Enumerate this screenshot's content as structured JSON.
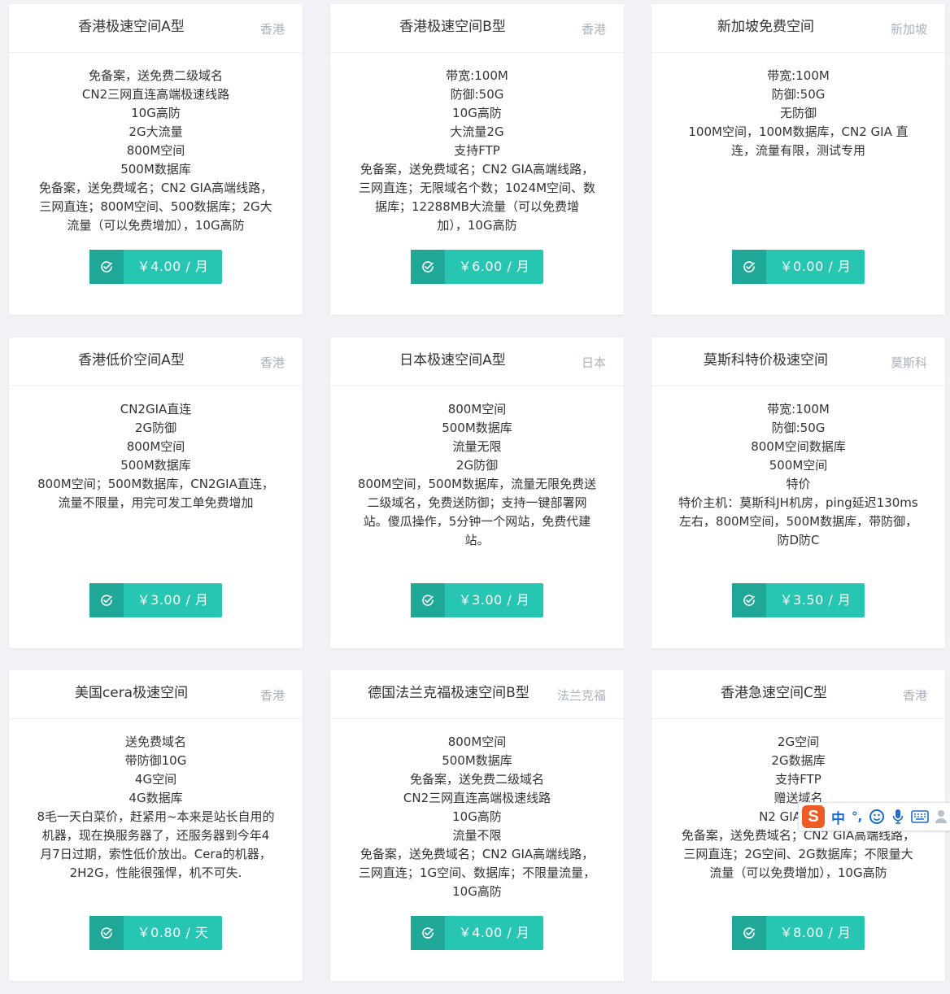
{
  "products": [
    {
      "title": "香港极速空间A型",
      "region": "香港",
      "lines": [
        "免备案，送免费二级域名",
        "CN2三网直连高端极速线路",
        "10G高防",
        "2G大流量",
        "800M空间",
        "500M数据库",
        "免备案，送免费域名；CN2 GIA高端线路，",
        "三网直连；800M空间、500数据库；2G大",
        "流量（可以免费增加），10G高防"
      ],
      "price": "￥4.00 / 月"
    },
    {
      "title": "香港极速空间B型",
      "region": "香港",
      "lines": [
        "带宽:100M",
        "防御:50G",
        "10G高防",
        "大流量2G",
        "支持FTP",
        "免备案，送免费域名；CN2 GIA高端线路，",
        "三网直连；无限域名个数；1024M空间、数",
        "据库；12288MB大流量（可以免费增",
        "加），10G高防"
      ],
      "price": "￥6.00 / 月"
    },
    {
      "title": "新加坡免费空间",
      "region": "新加坡",
      "lines": [
        "带宽:100M",
        "防御:50G",
        "无防御",
        "100M空间，100M数据库，CN2 GIA 直",
        "连，流量有限，测试专用"
      ],
      "price": "￥0.00 / 月"
    },
    {
      "title": "香港低价空间A型",
      "region": "香港",
      "lines": [
        "CN2GIA直连",
        "2G防御",
        "800M空间",
        "500M数据库",
        "800M空间；500M数据库，CN2GIA直连，",
        "流量不限量，用完可发工单免费增加"
      ],
      "price": "￥3.00 / 月"
    },
    {
      "title": "日本极速空间A型",
      "region": "日本",
      "lines": [
        "800M空间",
        "500M数据库",
        "流量无限",
        "2G防御",
        "800M空间，500M数据库，流量无限免费送",
        "二级域名，免费送防御；支持一键部署网",
        "站。傻瓜操作，5分钟一个网站，免费代建",
        "站。"
      ],
      "price": "￥3.00 / 月"
    },
    {
      "title": "莫斯科特价极速空间",
      "region": "莫斯科",
      "lines": [
        "带宽:100M",
        "防御:50G",
        "800M空间数据库",
        "500M空间",
        "特价",
        "特价主机：莫斯科JH机房，ping延迟130ms",
        "左右，800M空间，500M数据库，带防御，",
        "防D防C"
      ],
      "price": "￥3.50 / 月"
    },
    {
      "title": "美国cera极速空间",
      "region": "香港",
      "lines": [
        "送免费域名",
        "带防御10G",
        "4G空间",
        "4G数据库",
        "8毛一天白菜价，赶紧用~本来是站长自用的",
        "机器，现在换服务器了，还服务器到今年4",
        "月7日过期，索性低价放出。Cera的机器，",
        "2H2G，性能很强悍，机不可失."
      ],
      "price": "￥0.80 / 天"
    },
    {
      "title": "德国法兰克福极速空间B型",
      "region": "法兰克福",
      "lines": [
        "800M空间",
        "500M数据库",
        "免备案，送免费二级域名",
        "CN2三网直连高端极速线路",
        "10G高防",
        "流量不限",
        "免备案，送免费域名；CN2 GIA高端线路，",
        "三网直连；1G空间、数据库；不限量流量，",
        "10G高防"
      ],
      "price": "￥4.00 / 月"
    },
    {
      "title": "香港急速空间C型",
      "region": "香港",
      "lines": [
        "2G空间",
        "2G数据库",
        "支持FTP",
        "赠送域名",
        "N2 GIA高端线",
        "免备案，送免费域名；CN2 GIA高端线路，",
        "三网直连；2G空间、2G数据库；不限量大",
        "流量（可以免费增加），10G高防"
      ],
      "price": "￥8.00 / 月"
    }
  ],
  "ime_toolbar": {
    "logo": "S",
    "mode": "中",
    "punct": "°,"
  },
  "colors": {
    "button": "#26c6b2",
    "button_icon_bg": "#1fa898",
    "region_text": "#aab2bd"
  }
}
